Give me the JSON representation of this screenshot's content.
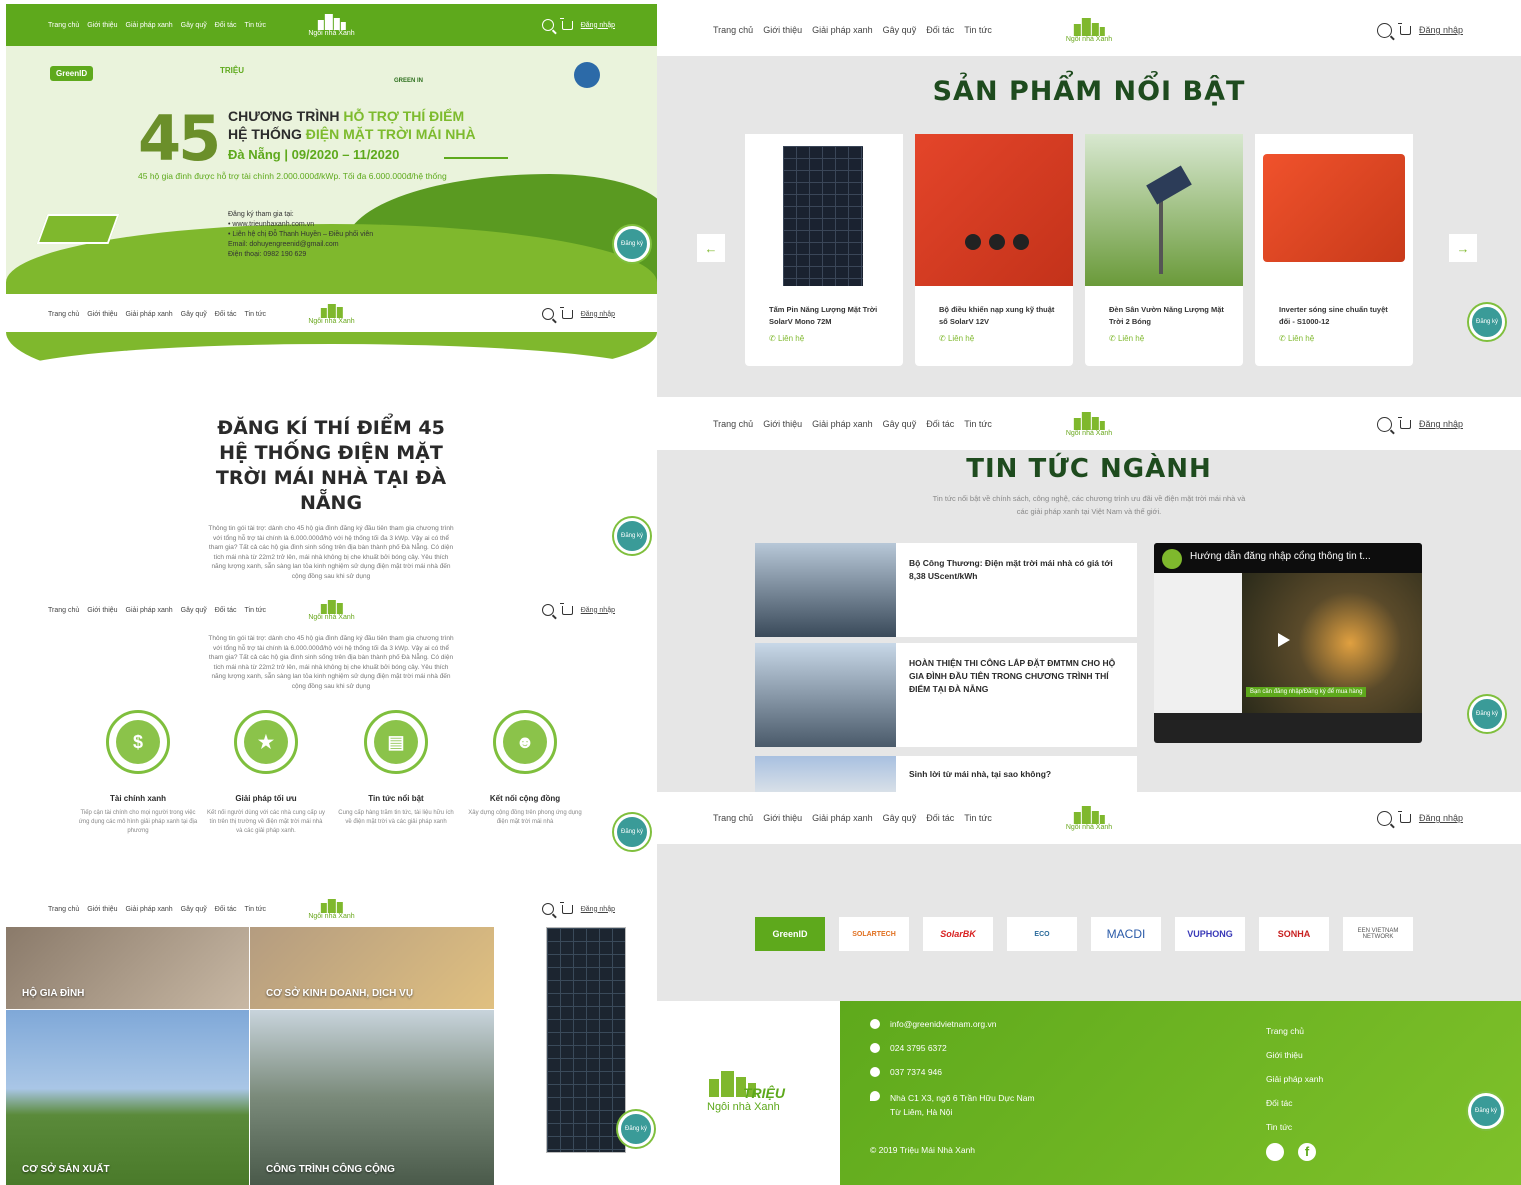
{
  "nav": {
    "links": [
      "Trang chủ",
      "Giới thiệu",
      "Giải pháp xanh",
      "Gây quỹ",
      "Đối tác",
      "Tin tức"
    ],
    "login": "Đăng nhập",
    "logo_text": "TRIỆU",
    "logo_sub": "Ngôi nhà Xanh"
  },
  "register_badge": "Đăng ký",
  "banner": {
    "partners": [
      "GreenID",
      "TRIỆU",
      "GREEN IN"
    ],
    "number": "45",
    "line1_a": "CHƯƠNG TRÌNH",
    "line1_b": "HỖ TRỢ THÍ ĐIỂM",
    "line2_a": "HỆ THỐNG",
    "line2_b": "ĐIỆN MẶT TRỜI MÁI NHÀ",
    "line3": "Đà Nẵng | 09/2020 – 11/2020",
    "subtitle": "45 hộ gia đình được hỗ trợ tài chính 2.000.000đ/kWp. Tối đa 6.000.000đ/hệ thống",
    "contact": [
      "Đăng ký tham gia tại:",
      "• www.trieunhaxanh.com.vn",
      "• Liên hệ chị Đỗ Thanh Huyền – Điều phối viên",
      "Email: dohuyengreenid@gmail.com",
      "Điện thoại: 0982 190 629"
    ]
  },
  "register_section": {
    "title": "ĐĂNG KÍ THÍ ĐIỂM 45 HỆ THỐNG ĐIỆN MẶT TRỜI MÁI NHÀ TẠI ĐÀ NẴNG",
    "paragraph": "Thông tin gói tài trợ: dành cho 45 hộ gia đình đăng ký đầu tiên tham gia chương trình với tổng hỗ trợ tài chính là 6.000.000đ/hộ với hệ thống tối đa 3 kWp. Vậy ai có thể tham gia? Tất cả các hộ gia đình sinh sống trên địa bàn thành phố Đà Nẵng. Có diện tích mái nhà từ 22m2 trở lên, mái nhà không bị che khuất bởi bóng cây. Yêu thích năng lượng xanh, sẵn sàng lan tỏa kinh nghiệm sử dụng điện mặt trời mái nhà đến cộng đồng sau khi sử dụng"
  },
  "features": [
    {
      "icon": "money-bag-icon",
      "glyph": "$",
      "title": "Tài chính xanh",
      "desc": "Tiếp cận tài chính cho mọi người trong việc ứng dụng các mô hình giải pháp xanh tại địa phương"
    },
    {
      "icon": "star-icon",
      "glyph": "★",
      "title": "Giải pháp tối ưu",
      "desc": "Kết nối người dùng với các nhà cung cấp uy tín trên thị trường về điện mặt trời mái nhà và các giải pháp xanh."
    },
    {
      "icon": "news-icon",
      "glyph": "▤",
      "title": "Tin tức nổi bật",
      "desc": "Cung cấp hàng trăm tin tức, tài liệu hữu ích về điện mặt trời và các giải pháp xanh"
    },
    {
      "icon": "community-icon",
      "glyph": "☻",
      "title": "Kết nối cộng đồng",
      "desc": "Xây dựng cộng đồng trên phong ứng dụng điện mặt trời mái nhà"
    }
  ],
  "tiles": [
    "HỘ GIA ĐÌNH",
    "CƠ SỞ KINH DOANH, DỊCH VỤ",
    "CƠ SỞ SẢN XUẤT",
    "CÔNG TRÌNH CÔNG CỘNG"
  ],
  "products": {
    "title": "SẢN PHẨM NỔI BẬT",
    "contact_label": "Liên hệ",
    "items": [
      {
        "name": "Tấm Pin Năng Lượng Mặt Trời SolarV Mono 72M"
      },
      {
        "name": "Bộ điều khiển nạp xung kỹ thuật số SolarV 12V"
      },
      {
        "name": "Đèn Sân Vườn Năng Lượng Mặt Trời 2 Bóng"
      },
      {
        "name": "Inverter sóng sine chuẩn tuyệt đối - S1000-12"
      }
    ]
  },
  "news": {
    "title": "TIN TỨC NGÀNH",
    "subtitle": "Tin tức nổi bật về chính sách, công nghệ, các chương trình ưu đãi về điện mặt trời mái nhà và các giải pháp xanh tại Việt Nam và thế giới.",
    "items": [
      "Bộ Công Thương: Điện mặt trời mái nhà có giá tới 8,38 UScent/kWh",
      "HOÀN THIỆN THI CÔNG LẮP ĐẶT ĐMTMN CHO HỘ GIA ĐÌNH ĐẦU TIÊN TRONG CHƯƠNG TRÌNH THÍ ĐIỂM TẠI ĐÀ NẴNG",
      "Sinh lời từ mái nhà, tại sao không?"
    ],
    "video_title": "Hướng dẫn đăng nhập cổng thông tin t...",
    "video_caption": "Bạn cần đăng nhập/Đăng ký để mua hàng"
  },
  "partners": [
    "GreenID",
    "SOLARTECH",
    "SolarBK",
    "ECO",
    "MACDI",
    "VUPHONG",
    "SONHA",
    "EEN VIETNAM NETWORK"
  ],
  "footer": {
    "email": "info@greenidvietnam.org.vn",
    "phone1": "024 3795 6372",
    "phone2": "037 7374 946",
    "address": "Nhà C1 X3, ngõ 6 Trần Hữu Dực Nam Từ Liêm, Hà Nội",
    "copyright": "© 2019 Triệu Mái Nhà Xanh",
    "links": [
      "Trang chủ",
      "Giới thiệu",
      "Giải pháp xanh",
      "Đối tác",
      "Tin tức"
    ]
  },
  "colors": {
    "brand_green": "#5ea91c",
    "dark_green": "#1e4b1e",
    "teal": "#3a9b98"
  }
}
